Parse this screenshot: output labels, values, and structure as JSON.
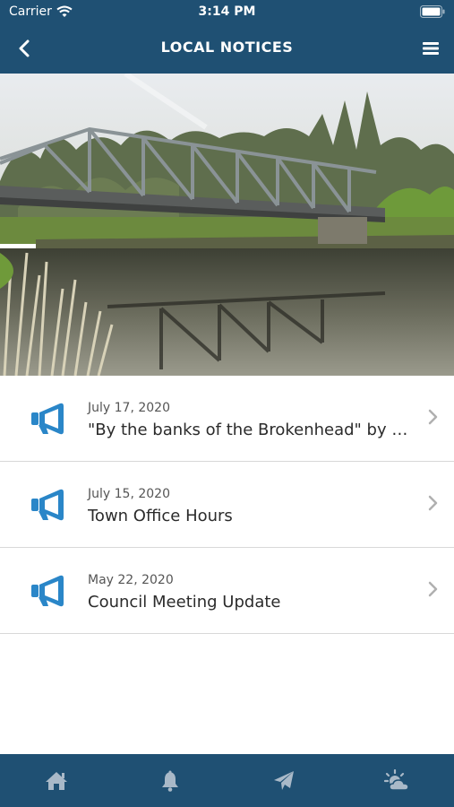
{
  "status_bar": {
    "carrier": "Carrier",
    "time": "3:14 PM"
  },
  "nav": {
    "title": "LOCAL NOTICES",
    "back_icon": "chevron-left-icon",
    "menu_icon": "hamburger-menu-icon"
  },
  "hero": {
    "subject": "steel truss bridge over river"
  },
  "notices": [
    {
      "date": "July 17, 2020",
      "title": "\"By the banks of the Brokenhead\" by K..."
    },
    {
      "date": "July 15, 2020",
      "title": "Town Office Hours"
    },
    {
      "date": "May 22, 2020",
      "title": "Council Meeting Update"
    }
  ],
  "tabs": [
    {
      "icon": "home-icon"
    },
    {
      "icon": "bell-icon"
    },
    {
      "icon": "paper-plane-icon"
    },
    {
      "icon": "weather-sun-cloud-icon"
    }
  ],
  "colors": {
    "primary": "#1f5073",
    "accent": "#2a86c8",
    "tab_icon": "#a9b9c8"
  }
}
